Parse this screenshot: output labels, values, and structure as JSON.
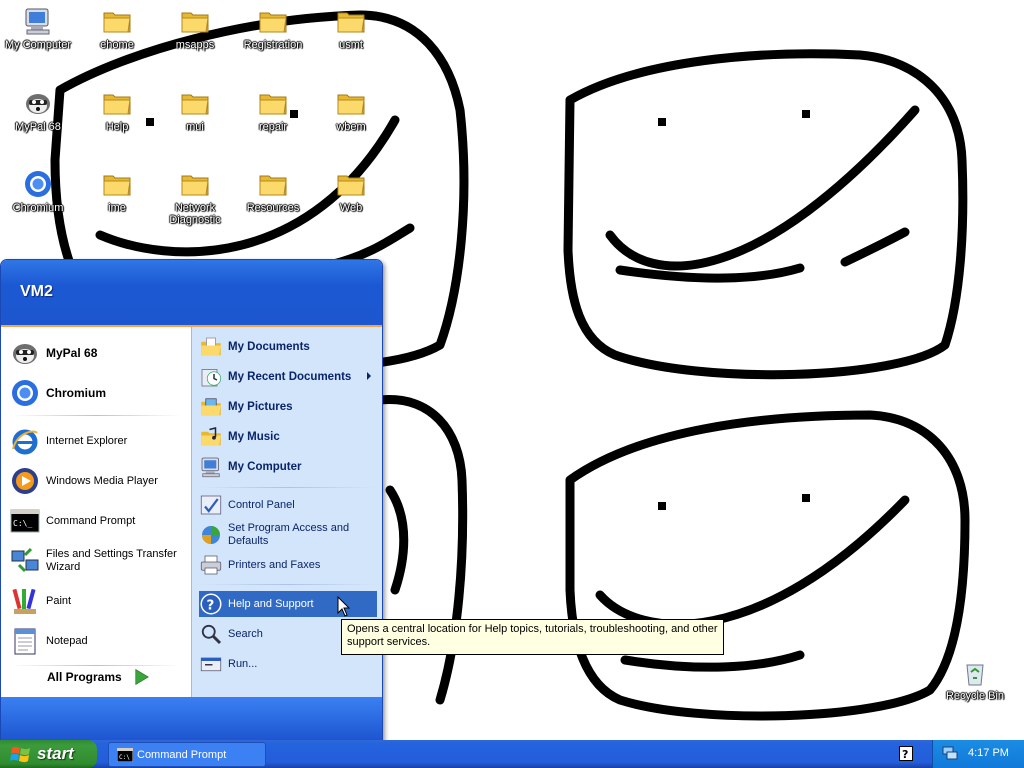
{
  "desktop": {
    "icons": [
      {
        "label": "My Computer",
        "icon": "my-computer-icon"
      },
      {
        "label": "ehome",
        "icon": "folder-icon"
      },
      {
        "label": "msapps",
        "icon": "folder-icon"
      },
      {
        "label": "Registration",
        "icon": "folder-icon"
      },
      {
        "label": "usmt",
        "icon": "folder-icon"
      },
      {
        "label": "MyPal 68",
        "icon": "mypal-icon"
      },
      {
        "label": "Help",
        "icon": "folder-icon"
      },
      {
        "label": "mui",
        "icon": "folder-icon"
      },
      {
        "label": "repair",
        "icon": "folder-icon"
      },
      {
        "label": "wbem",
        "icon": "folder-icon"
      },
      {
        "label": "Chromium",
        "icon": "chromium-icon"
      },
      {
        "label": "ime",
        "icon": "folder-icon"
      },
      {
        "label": "Network Diagnostic",
        "icon": "folder-icon"
      },
      {
        "label": "Resources",
        "icon": "folder-icon"
      },
      {
        "label": "Web",
        "icon": "folder-icon"
      },
      {
        "label": "Recycle Bin",
        "icon": "recycle-bin-icon"
      }
    ]
  },
  "start_menu": {
    "user": "VM2",
    "pinned": [
      {
        "label": "MyPal 68",
        "icon": "mypal-icon"
      },
      {
        "label": "Chromium",
        "icon": "chromium-icon"
      }
    ],
    "recent": [
      {
        "label": "Internet Explorer",
        "icon": "internet-explorer-icon"
      },
      {
        "label": "Windows Media Player",
        "icon": "media-player-icon"
      },
      {
        "label": "Command Prompt",
        "icon": "command-prompt-icon"
      },
      {
        "label": "Files and Settings Transfer Wizard",
        "icon": "transfer-wizard-icon"
      },
      {
        "label": "Paint",
        "icon": "paint-icon"
      },
      {
        "label": "Notepad",
        "icon": "notepad-icon"
      }
    ],
    "all_programs": "All Programs",
    "places": [
      {
        "label": "My Documents",
        "icon": "my-documents-icon"
      },
      {
        "label": "My Recent Documents",
        "icon": "recent-documents-icon"
      },
      {
        "label": "My Pictures",
        "icon": "my-pictures-icon"
      },
      {
        "label": "My Music",
        "icon": "my-music-icon"
      },
      {
        "label": "My Computer",
        "icon": "my-computer-icon"
      }
    ],
    "settings": [
      {
        "label": "Control Panel",
        "icon": "control-panel-icon"
      },
      {
        "label": "Set Program Access and Defaults",
        "icon": "program-access-icon"
      },
      {
        "label": "Printers and Faxes",
        "icon": "printer-icon"
      }
    ],
    "tools": [
      {
        "label": "Help and Support",
        "icon": "help-icon"
      },
      {
        "label": "Search",
        "icon": "search-icon"
      },
      {
        "label": "Run...",
        "icon": "run-icon"
      }
    ],
    "tooltip": "Opens a central location for Help topics, tutorials, troubleshooting, and other support services."
  },
  "taskbar": {
    "start_label": "start",
    "tasks": [
      {
        "label": "Command Prompt",
        "icon": "command-prompt-icon"
      }
    ],
    "clock": "4:17 PM"
  },
  "colors": {
    "highlight": "#316ac5",
    "start_green": "#3c9b3c",
    "taskbar_blue": "#245dda",
    "tooltip_bg": "#ffffe1"
  }
}
